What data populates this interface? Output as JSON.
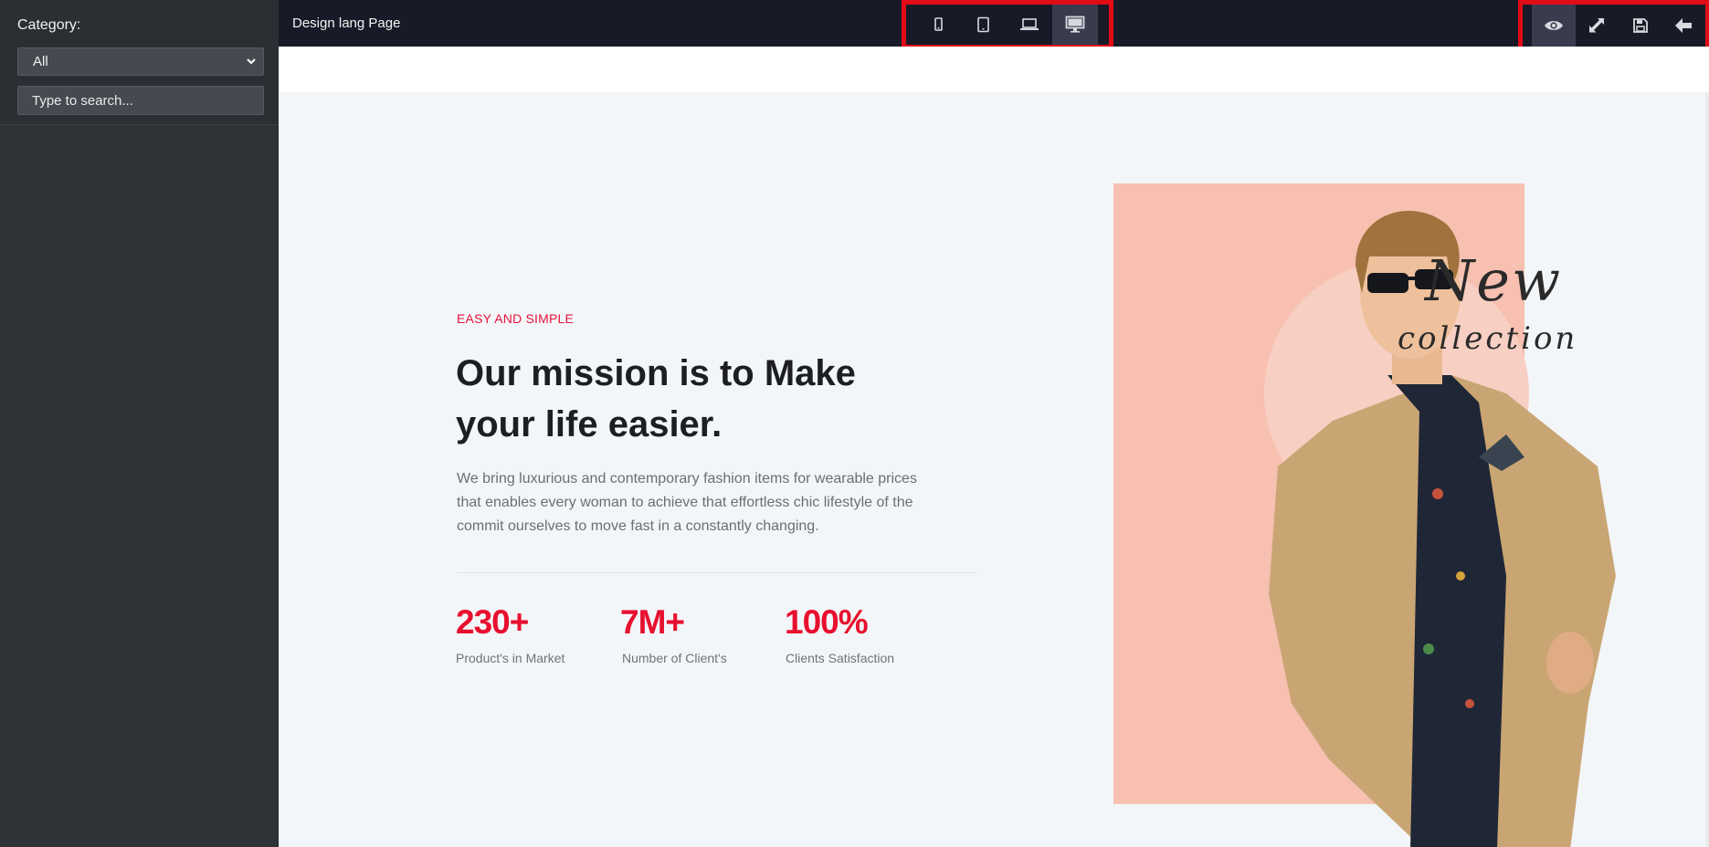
{
  "sidebar": {
    "category_label": "Category:",
    "category_value": "All",
    "search_placeholder": "Type to search..."
  },
  "topbar": {
    "page_name": "Design lang Page",
    "devices": [
      {
        "icon": "mobile-icon",
        "active": false
      },
      {
        "icon": "tablet-icon",
        "active": false
      },
      {
        "icon": "laptop-icon",
        "active": false
      },
      {
        "icon": "desktop-icon",
        "active": true
      }
    ],
    "actions": [
      {
        "icon": "eye-icon",
        "active": true
      },
      {
        "icon": "expand-icon",
        "active": false
      },
      {
        "icon": "save-icon",
        "active": false
      },
      {
        "icon": "back-arrow-icon",
        "active": false
      }
    ],
    "highlight_color": "#e10c16"
  },
  "hero": {
    "eyebrow": "EASY AND SIMPLE",
    "headline_line1": "Our mission is to Make",
    "headline_line2": "your life easier.",
    "description": "We bring luxurious and contemporary fashion items for wearable prices that enables every woman to achieve that effortless chic lifestyle of the commit ourselves to move fast in a constantly changing.",
    "stats": [
      {
        "value": "230+",
        "label": "Product's in Market"
      },
      {
        "value": "7M+",
        "label": "Number of Client's"
      },
      {
        "value": "100%",
        "label": "Clients Satisfaction"
      }
    ],
    "image_text_line1": "New",
    "image_text_line2": "collection",
    "accent_color": "#e8102f",
    "card_color": "#f7c0b0"
  }
}
